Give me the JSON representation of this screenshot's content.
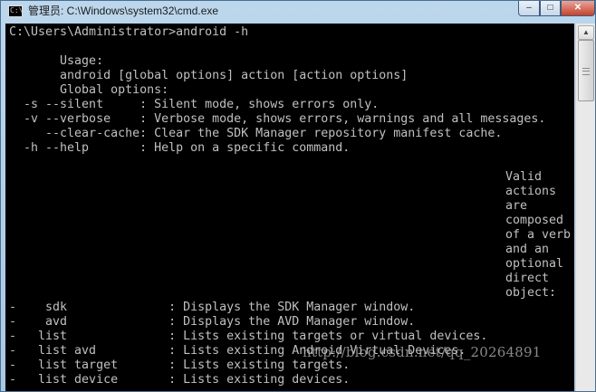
{
  "window": {
    "title": "管理员: C:\\Windows\\system32\\cmd.exe",
    "icon_label": "C:\\",
    "buttons": {
      "minimize": "–",
      "maximize": "□",
      "close": "✕"
    }
  },
  "console": {
    "lines": [
      "C:\\Users\\Administrator>android -h",
      "",
      "       Usage:",
      "       android [global options] action [action options]",
      "       Global options:",
      "  -s --silent     : Silent mode, shows errors only.",
      "  -v --verbose    : Verbose mode, shows errors, warnings and all messages.",
      "     --clear-cache: Clear the SDK Manager repository manifest cache.",
      "  -h --help       : Help on a specific command."
    ],
    "side_note": [
      "Valid",
      "actions",
      "are",
      "composed",
      "of a verb",
      "and an",
      "optional",
      "direct",
      "object:"
    ],
    "actions": [
      "-    sdk              : Displays the SDK Manager window.",
      "-    avd              : Displays the AVD Manager window.",
      "-   list              : Lists existing targets or virtual devices.",
      "-   list avd          : Lists existing Android Virtual Devices.",
      "-   list target       : Lists existing targets.",
      "-   list device       : Lists existing devices."
    ]
  },
  "watermark": "http://blog.csdn.net/qq_20264891",
  "scrollbar": {
    "up_arrow": "▲"
  }
}
